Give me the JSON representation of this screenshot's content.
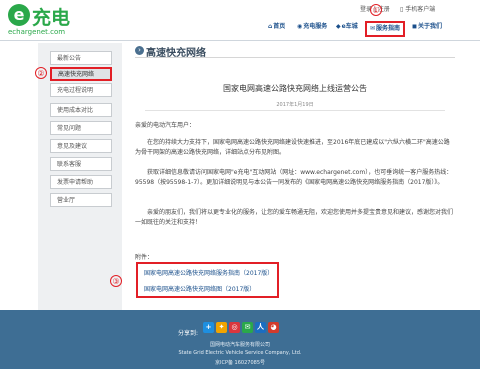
{
  "header": {
    "logo_mark": "e",
    "logo_text": "充电",
    "logo_url": "echargenet.com",
    "top_links": "登录 | 注册",
    "mobile_label": "手机客户端",
    "nav": [
      {
        "label": "首页",
        "icon": "⌂"
      },
      {
        "label": "充电服务",
        "icon": "◉"
      },
      {
        "label": "e车城",
        "icon": "◆"
      },
      {
        "label": "服务指南",
        "icon": "✉"
      },
      {
        "label": "关于我们",
        "icon": "◼"
      }
    ]
  },
  "callouts": {
    "one": "①",
    "two": "②",
    "three": "③"
  },
  "sidebar": {
    "items": [
      "最新公告",
      "高速快充网络",
      "充电过程说明",
      "使用成本对比",
      "常见问题",
      "意见及建议",
      "联系客服",
      "发票申请帮助",
      "营业厅"
    ]
  },
  "section": {
    "title": "高速快充网络"
  },
  "article": {
    "title": "国家电网高速公路快充网络上线运营公告",
    "date": "2017年1月19日",
    "greeting": "亲爱的电动汽车用户：",
    "p1": "在您的持续大力支持下，国家电网高速公路快充网络建设快速推进，至2016年底已建成以\"六纵六横二环\"高速公路为骨干网架的高速公路快充网络，详细站点分布见附图。",
    "p2": "获取详细信息敬请访问国家电网\"e充电\"互动网站（网址：www.echargenet.com），也可垂询统一客户服务热线：95598（按95598-1-7）。更加详细说明见与本公告一同发布的《国家电网高速公路快充网络服务指南（2017版）》。",
    "p3": "亲爱的朋友们，我们将以更专业化的服务，让您的爱车畅通无阻，欢迎您使用并多提宝贵意见和建议，感谢您对我们一如既往的关注和支持！",
    "attachment_label": "附件：",
    "attachments": [
      "国家电网高速公路快充网络服务指南（2017版）",
      "国家电网高速公路快充网络图（2017版）"
    ]
  },
  "footer": {
    "share_label": "分享到:",
    "share_icons": [
      "+",
      "✦",
      "◎",
      "✉",
      "人",
      "◕"
    ],
    "company": "国网电动汽车服务有限公司",
    "company_en": "State Grid Electric Vehicle Service Company, Ltd.",
    "icp": "京ICP备 16027085号"
  },
  "colors": {
    "brand_green": "#2aa84a",
    "nav_blue": "#1a4f8b",
    "highlight_red": "#e21f26",
    "footer_blue": "#3e6e94"
  }
}
